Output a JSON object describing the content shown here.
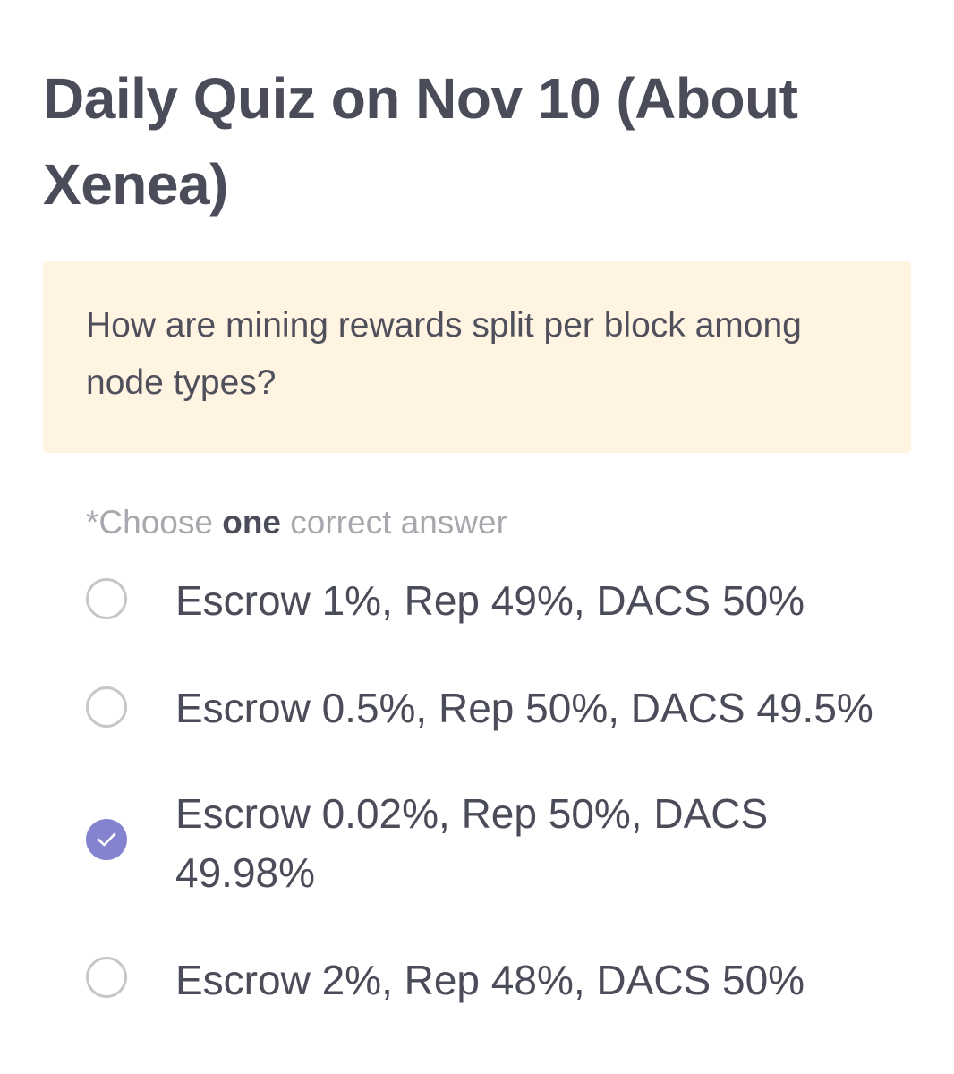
{
  "quiz": {
    "title": "Daily Quiz on Nov 10 (About Xenea)",
    "question": "How are mining rewards split per block among node types?",
    "instruction": {
      "prefix": "*Choose ",
      "emphasis": "one",
      "suffix": " correct answer"
    },
    "options": [
      {
        "label": "Escrow 1%, Rep 49%, DACS 50%",
        "selected": false
      },
      {
        "label": "Escrow 0.5%, Rep 50%, DACS 49.5%",
        "selected": false
      },
      {
        "label": "Escrow 0.02%, Rep 50%, DACS 49.98%",
        "selected": true
      },
      {
        "label": "Escrow 2%, Rep 48%, DACS 50%",
        "selected": false
      }
    ]
  },
  "colors": {
    "question_background": "#fff3e2",
    "selected_radio": "#8383cf",
    "text": "#4b4c59",
    "muted_text": "#a7a8ae"
  }
}
